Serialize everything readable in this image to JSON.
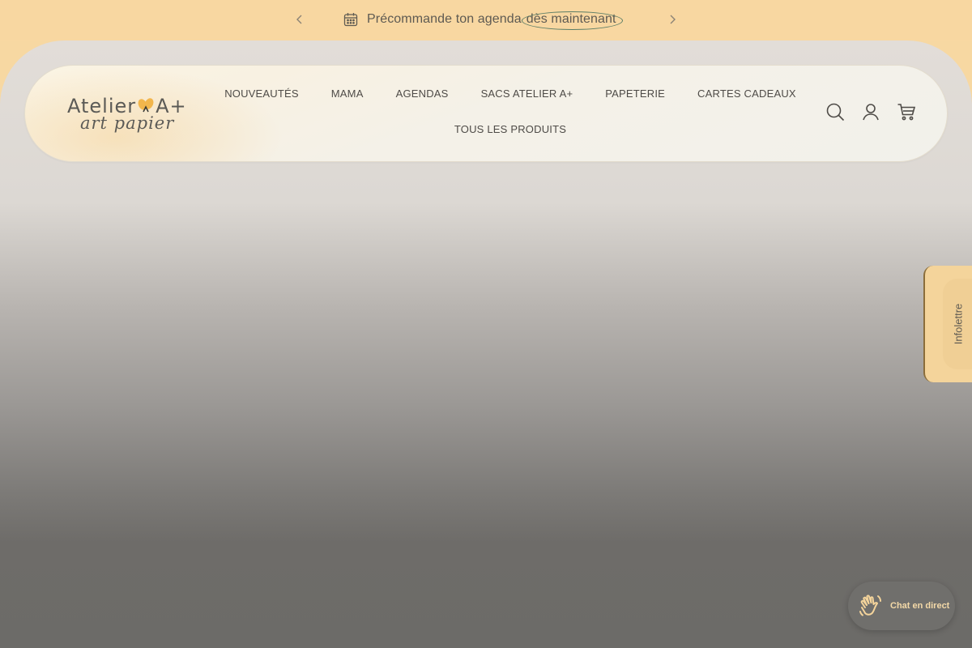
{
  "announcement": {
    "text": "Précommande ton agenda",
    "link": "dès maintenant",
    "icon": "calendar-icon"
  },
  "header": {
    "logo": {
      "main": "Atelier",
      "suffix": "A+",
      "sub": "art papier"
    },
    "nav": {
      "row1": [
        "Nouveautés",
        "Mama",
        "Agendas",
        "Sacs Atelier A+",
        "Papeterie",
        "Cartes cadeaux"
      ],
      "row2": [
        "Tous les produits"
      ]
    },
    "icons": [
      "search-icon",
      "account-icon",
      "cart-icon"
    ]
  },
  "newsletter": {
    "label": "Infolettre"
  },
  "chat": {
    "label": "Chat en direct",
    "icon": "waving-hand-icon"
  },
  "colors": {
    "announcement_bg": "#f8d7a1",
    "accent": "#f4d49b",
    "text": "#4e4b47",
    "chat_bg": "#706f6c"
  }
}
